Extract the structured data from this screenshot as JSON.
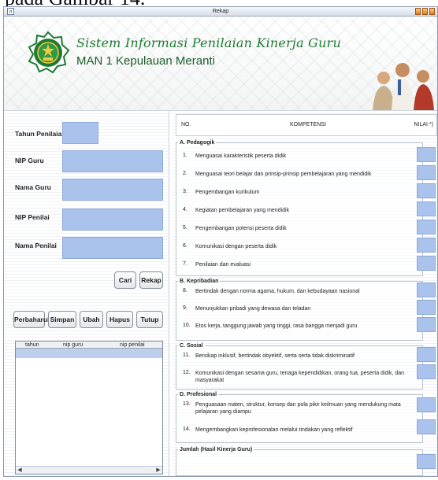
{
  "caption": "pada Gambar 14.",
  "window": {
    "title": "Rekap",
    "app_name": "Sistem Informasi Penilaian Kinerja Guru",
    "school": "MAN 1 Kepulauan Meranti"
  },
  "form": {
    "tahun_label": "Tahun Penilaian",
    "nip_guru_label": "NIP Guru",
    "nama_guru_label": "Nama Guru",
    "nip_penilai_label": "NIP Penilai",
    "nama_penilai_label": "Nama Penilai"
  },
  "buttons": {
    "cari": "Cari",
    "rekap": "Rekap",
    "perbaharui": "Perbaharui",
    "simpan": "Simpan",
    "ubah": "Ubah",
    "hapus": "Hapus",
    "tutup": "Tutup"
  },
  "grid": {
    "columns": [
      "tahun",
      "nip guru",
      "nip penilai"
    ]
  },
  "competency": {
    "col_no": "NO.",
    "col_kompetensi": "KOMPETENSI",
    "col_nilai": "NILAI *)",
    "groups": [
      {
        "title": "A. Pedagogik",
        "items": [
          {
            "no": "1.",
            "text": "Menguasai karakteristik peserta didik"
          },
          {
            "no": "2.",
            "text": "Menguasai teori belajar dan prinsip-prinsip pembelajaran yang mendidik"
          },
          {
            "no": "3.",
            "text": "Pengembangan kurikulum"
          },
          {
            "no": "4.",
            "text": "Kegiatan pembelajaran yang mendidik"
          },
          {
            "no": "5.",
            "text": "Pengembangan potensi peserta didik"
          },
          {
            "no": "6.",
            "text": "Komunikasi dengan peserta didik"
          },
          {
            "no": "7.",
            "text": "Penilaian dan evaluasi"
          }
        ]
      },
      {
        "title": "B. Kepribadian",
        "items": [
          {
            "no": "8.",
            "text": "Bertindak dengan norma agama, hukum, dan kebudayaan nasional"
          },
          {
            "no": "9.",
            "text": "Menunjukkan pribadi yang dewasa dan teladan"
          },
          {
            "no": "10.",
            "text": "Etos kerja, tanggung jawab yang tinggi, rasa bangga menjadi guru"
          }
        ]
      },
      {
        "title": "C. Sosial",
        "items": [
          {
            "no": "11.",
            "text": "Bersikap inklusif, bertindak obyektif, serta serta tidak diskriminatif"
          },
          {
            "no": "12.",
            "text": "Komunikasi dengan sesama guru, tenaga kependidikan, orang tua, peserta didik, dan masyarakat"
          }
        ]
      },
      {
        "title": "D. Profesional",
        "items": [
          {
            "no": "13.",
            "text": "Penguasaan materi, struktur, konsep dan pola pikir keilmuan yang mendukung mata pelajaran yang diampu"
          },
          {
            "no": "14.",
            "text": "Mengembangkan keprofesionalan melalui tindakan yang reflektif"
          }
        ]
      }
    ],
    "total_label": "Jumlah (Hasil Kinerja Guru)"
  },
  "colors": {
    "field": "#a9c3ec",
    "brand_green": "#1f7a33",
    "titlebar_buttons": "#e07a22"
  }
}
